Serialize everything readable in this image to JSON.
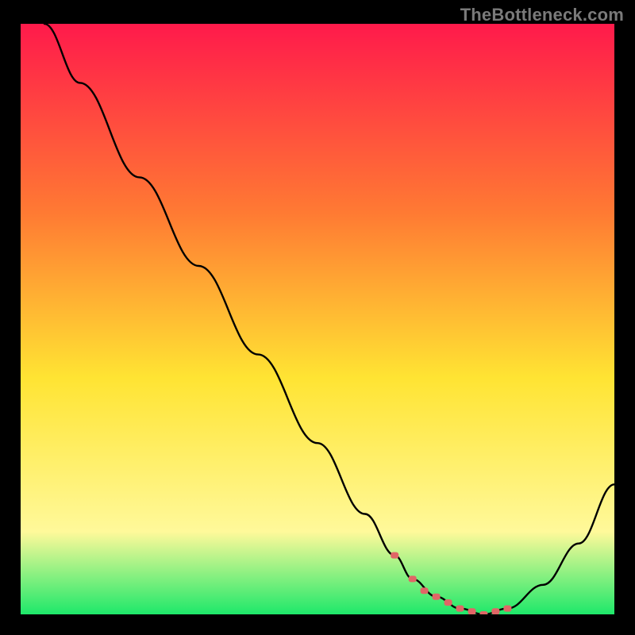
{
  "watermark": "TheBottleneck.com",
  "chart_data": {
    "type": "line",
    "title": "",
    "xlabel": "",
    "ylabel": "",
    "xlim": [
      0,
      100
    ],
    "ylim": [
      0,
      100
    ],
    "grid": false,
    "gradient_colors": {
      "top": "#ff1a4b",
      "mid_upper": "#ff7a33",
      "mid": "#ffe433",
      "mid_lower": "#fff99a",
      "bottom": "#1ee86a"
    },
    "series": [
      {
        "name": "curve",
        "x": [
          4,
          10,
          20,
          30,
          40,
          50,
          58,
          63,
          66,
          70,
          74,
          78,
          82,
          88,
          94,
          100
        ],
        "values": [
          100,
          90,
          74,
          59,
          44,
          29,
          17,
          10,
          6,
          3,
          1,
          0,
          1,
          5,
          12,
          22
        ]
      }
    ],
    "markers": {
      "name": "highlighted-points",
      "color": "#e06666",
      "x": [
        63,
        66,
        68,
        70,
        72,
        74,
        76,
        78,
        80,
        82
      ],
      "values": [
        10,
        6,
        4,
        3,
        2,
        1,
        0.5,
        0,
        0.5,
        1
      ]
    }
  }
}
